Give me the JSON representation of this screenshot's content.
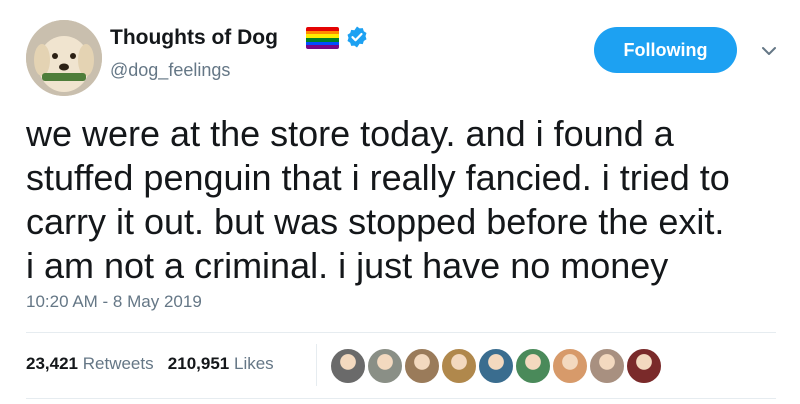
{
  "profile": {
    "display_name": "Thoughts of Dog",
    "handle": "@dog_feelings",
    "avatar_icon": "dog-avatar-icon",
    "flag_icon": "rainbow-flag-icon",
    "verified_icon": "verified-badge-icon",
    "flag_colors": [
      "#e40303",
      "#ff8c00",
      "#ffed00",
      "#008026",
      "#004dff",
      "#750787"
    ],
    "verified_color": "#1da1f2"
  },
  "actions": {
    "follow_label": "Following",
    "caret_icon": "chevron-down-icon",
    "accent": "#1da1f2"
  },
  "tweet": {
    "lines": [
      "we were at the store today. and i found a",
      "stuffed penguin that i really fancied. i tried to",
      "carry it out. but was stopped before the exit.",
      "i am not a criminal. i just have no money"
    ],
    "timestamp": "10:20 AM - 8 May 2019"
  },
  "stats": {
    "retweets_count": "23,421",
    "retweets_label": "Retweets",
    "likes_count": "210,951",
    "likes_label": "Likes"
  },
  "likers": [
    {
      "icon": "liker-avatar-icon",
      "color": "#6a6a6a"
    },
    {
      "icon": "liker-avatar-icon",
      "color": "#8a8f86"
    },
    {
      "icon": "liker-avatar-icon",
      "color": "#9a7b5a"
    },
    {
      "icon": "liker-avatar-icon",
      "color": "#b0884c"
    },
    {
      "icon": "liker-avatar-icon",
      "color": "#3a6d8f"
    },
    {
      "icon": "liker-avatar-icon",
      "color": "#4a8a5a"
    },
    {
      "icon": "liker-avatar-icon",
      "color": "#d79a6a"
    },
    {
      "icon": "liker-avatar-icon",
      "color": "#a89080"
    },
    {
      "icon": "liker-avatar-icon",
      "color": "#7a2a2a"
    }
  ]
}
